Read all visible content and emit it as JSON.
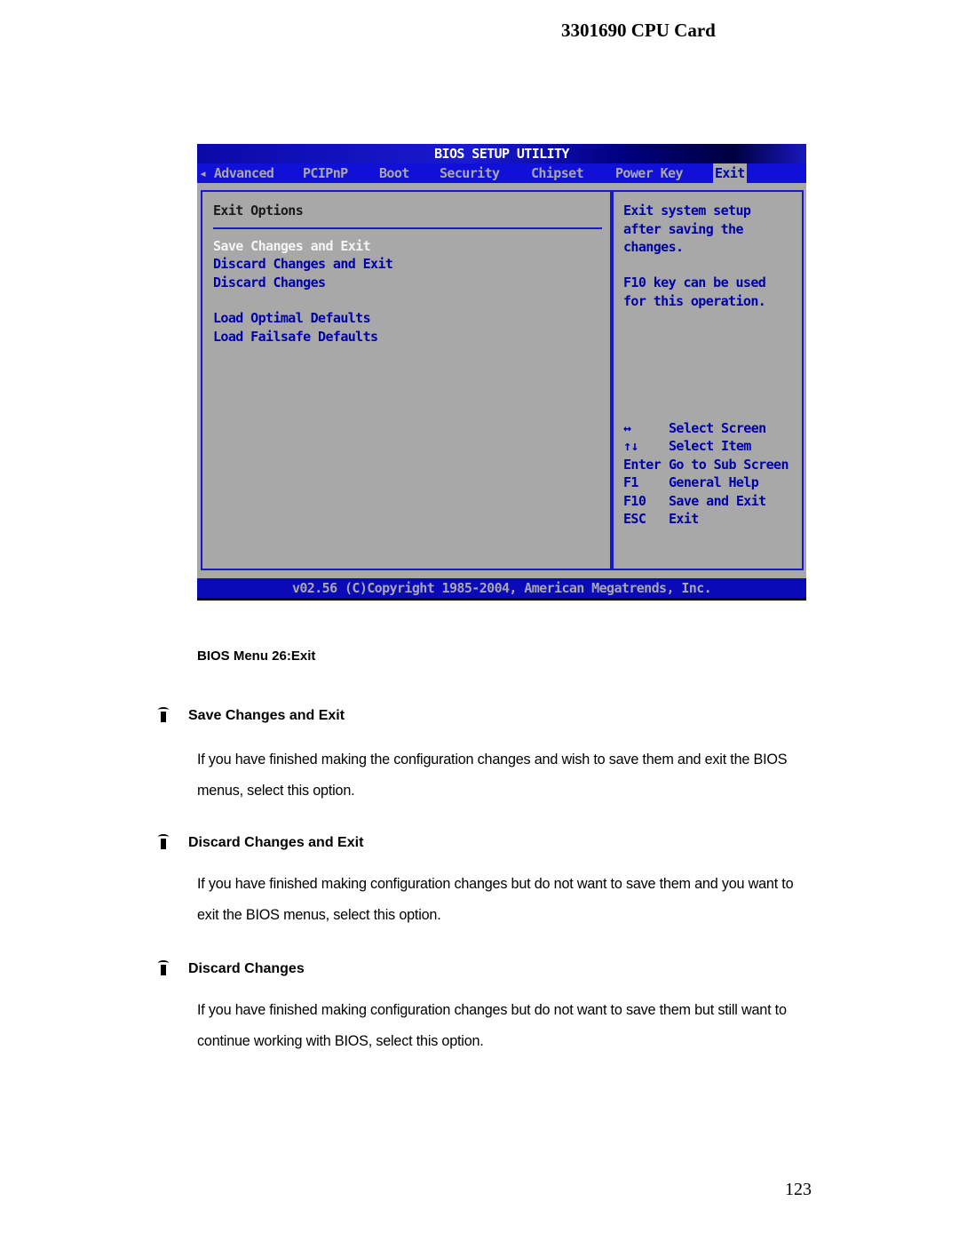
{
  "document": {
    "header": "3301690 CPU Card",
    "page_number": "123",
    "figure_caption": "BIOS Menu 26:Exit"
  },
  "bios": {
    "title": "BIOS SETUP UTILITY",
    "tabs": [
      {
        "label": "◂ Advanced",
        "active": false
      },
      {
        "label": "PCIPnP",
        "active": false
      },
      {
        "label": "Boot",
        "active": false
      },
      {
        "label": "Security",
        "active": false
      },
      {
        "label": "Chipset",
        "active": false
      },
      {
        "label": "Power Key",
        "active": false
      },
      {
        "label": "Exit",
        "active": true
      }
    ],
    "section_title": "Exit Options",
    "options": [
      {
        "label": "Save Changes and Exit",
        "selected": true
      },
      {
        "label": "Discard Changes and Exit",
        "selected": false
      },
      {
        "label": "Discard Changes",
        "selected": false
      },
      {
        "label": "Load Optimal Defaults",
        "selected": false
      },
      {
        "label": "Load Failsafe Defaults",
        "selected": false
      }
    ],
    "help_text_1": "Exit system setup\nafter saving the\nchanges.",
    "help_text_2": "F10 key can be used\nfor this operation.",
    "key_legend": [
      {
        "key": "↔",
        "action": "Select Screen"
      },
      {
        "key": "↑↓",
        "action": "Select Item"
      },
      {
        "key": "Enter",
        "action": "Go to Sub Screen"
      },
      {
        "key": "F1",
        "action": "General Help"
      },
      {
        "key": "F10",
        "action": "Save and Exit"
      },
      {
        "key": "ESC",
        "action": "Exit"
      }
    ],
    "footer": "v02.56 (C)Copyright 1985-2004, American Megatrends, Inc.",
    "colors": {
      "background": "#a8a8a8",
      "bar_blue": "#1010d8",
      "text_blue": "#0000a8",
      "selected_text": "#f4f4f4"
    }
  },
  "sections": [
    {
      "heading": "Save Changes and Exit",
      "body": "If you have finished making the configuration changes and wish to save them and exit the BIOS menus, select this option."
    },
    {
      "heading": "Discard Changes and Exit",
      "body": "If you have finished making configuration changes but do not want to save them and you want to exit the BIOS menus, select this option."
    },
    {
      "heading": "Discard Changes",
      "body": "If you have finished making configuration changes but do not want to save them but still want to continue working with BIOS, select this option."
    }
  ]
}
